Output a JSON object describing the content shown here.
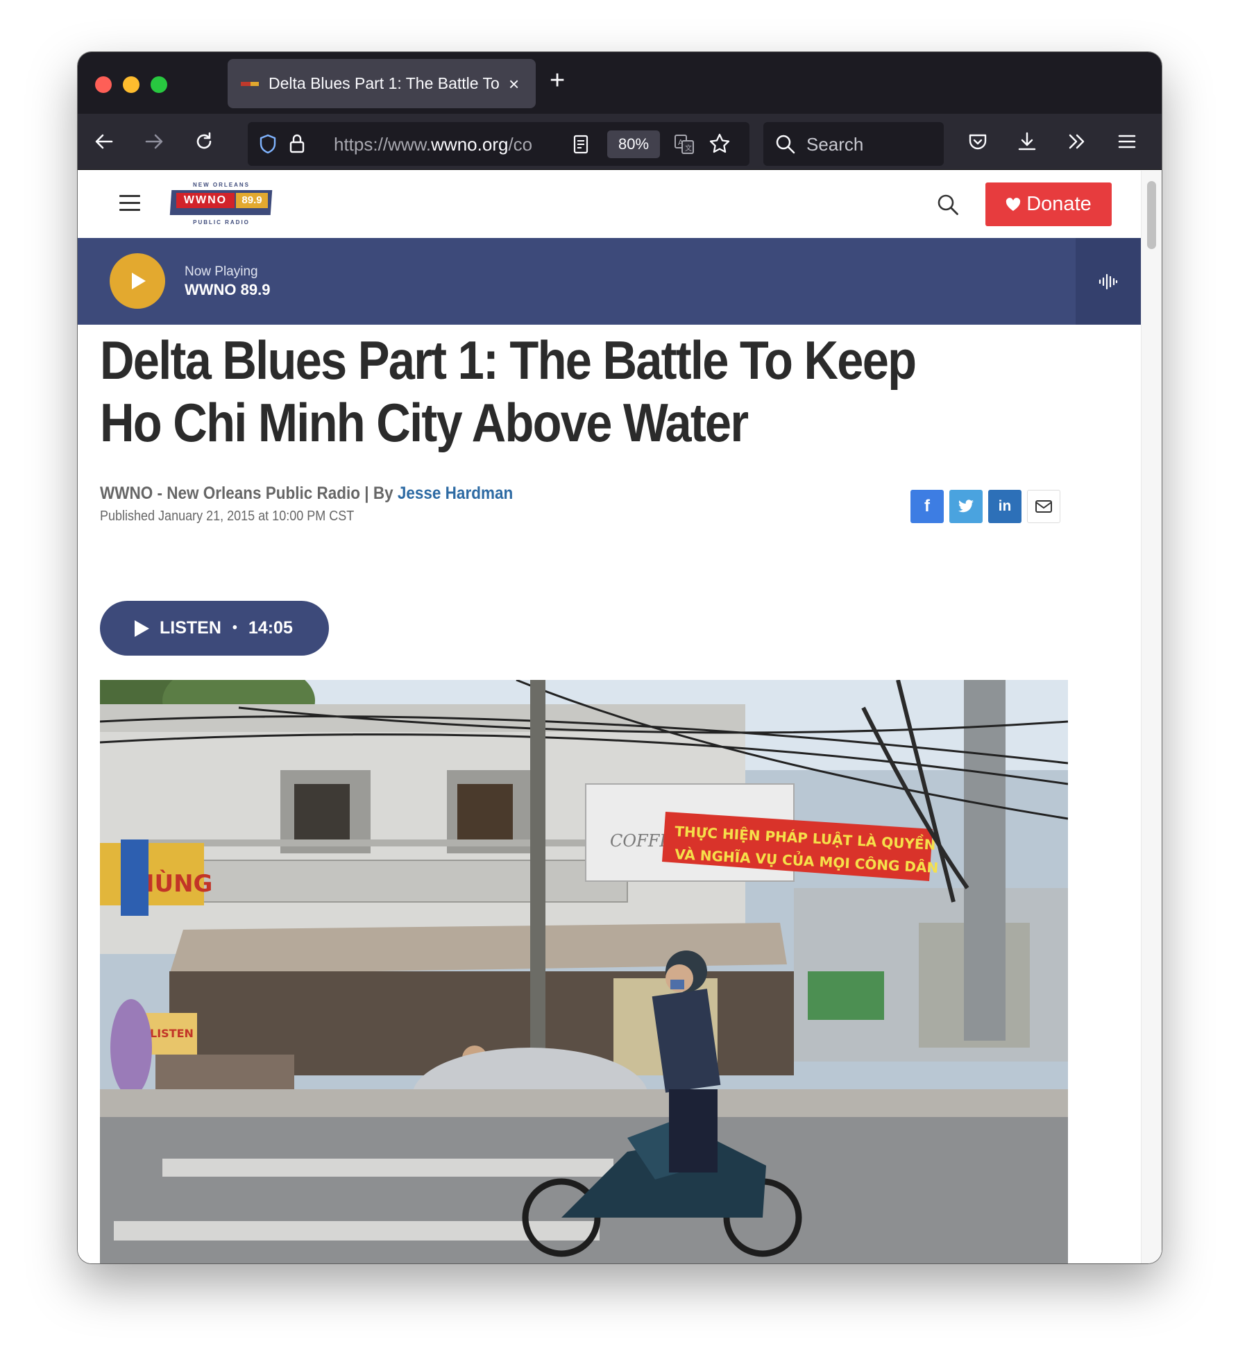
{
  "browser": {
    "tab_title": "Delta Blues Part 1: The Battle To",
    "new_tab_symbol": "+",
    "tab_close_symbol": "×",
    "url_prefix": "https://www.",
    "url_domain": "wwno.org",
    "url_suffix": "/co",
    "zoom": "80%",
    "search_placeholder": "Search"
  },
  "site": {
    "logo_top": "NEW ORLEANS",
    "logo_name": "WWNO",
    "logo_freq": "89.9",
    "logo_bottom": "PUBLIC RADIO",
    "donate_label": "Donate"
  },
  "player": {
    "label": "Now Playing",
    "station": "WWNO 89.9"
  },
  "article": {
    "headline": "Delta Blues Part 1: The Battle To Keep Ho Chi Minh City Above Water",
    "source": "WWNO - New Orleans Public Radio | By ",
    "author": "Jesse Hardman",
    "published": "Published January 21, 2015 at 10:00 PM CST",
    "listen_label": "LISTEN",
    "listen_separator": "•",
    "duration": "14:05",
    "share": {
      "facebook": "f",
      "linkedin": "in"
    }
  },
  "photo_text": {
    "sign_shop": "HÙNG",
    "sign_listen": "LISTEN",
    "banner_line1": "THỰC HIỆN PHÁP LUẬT LÀ QUYỀN",
    "banner_line2": "VÀ NGHĨA VỤ CỦA MỌI CÔNG DÂN",
    "billboard": "COFFEE"
  },
  "colors": {
    "brand_blue": "#3d4a7a",
    "brand_gold": "#e3a92f",
    "donate_red": "#e73c3e",
    "author_link": "#2d6aa3"
  }
}
